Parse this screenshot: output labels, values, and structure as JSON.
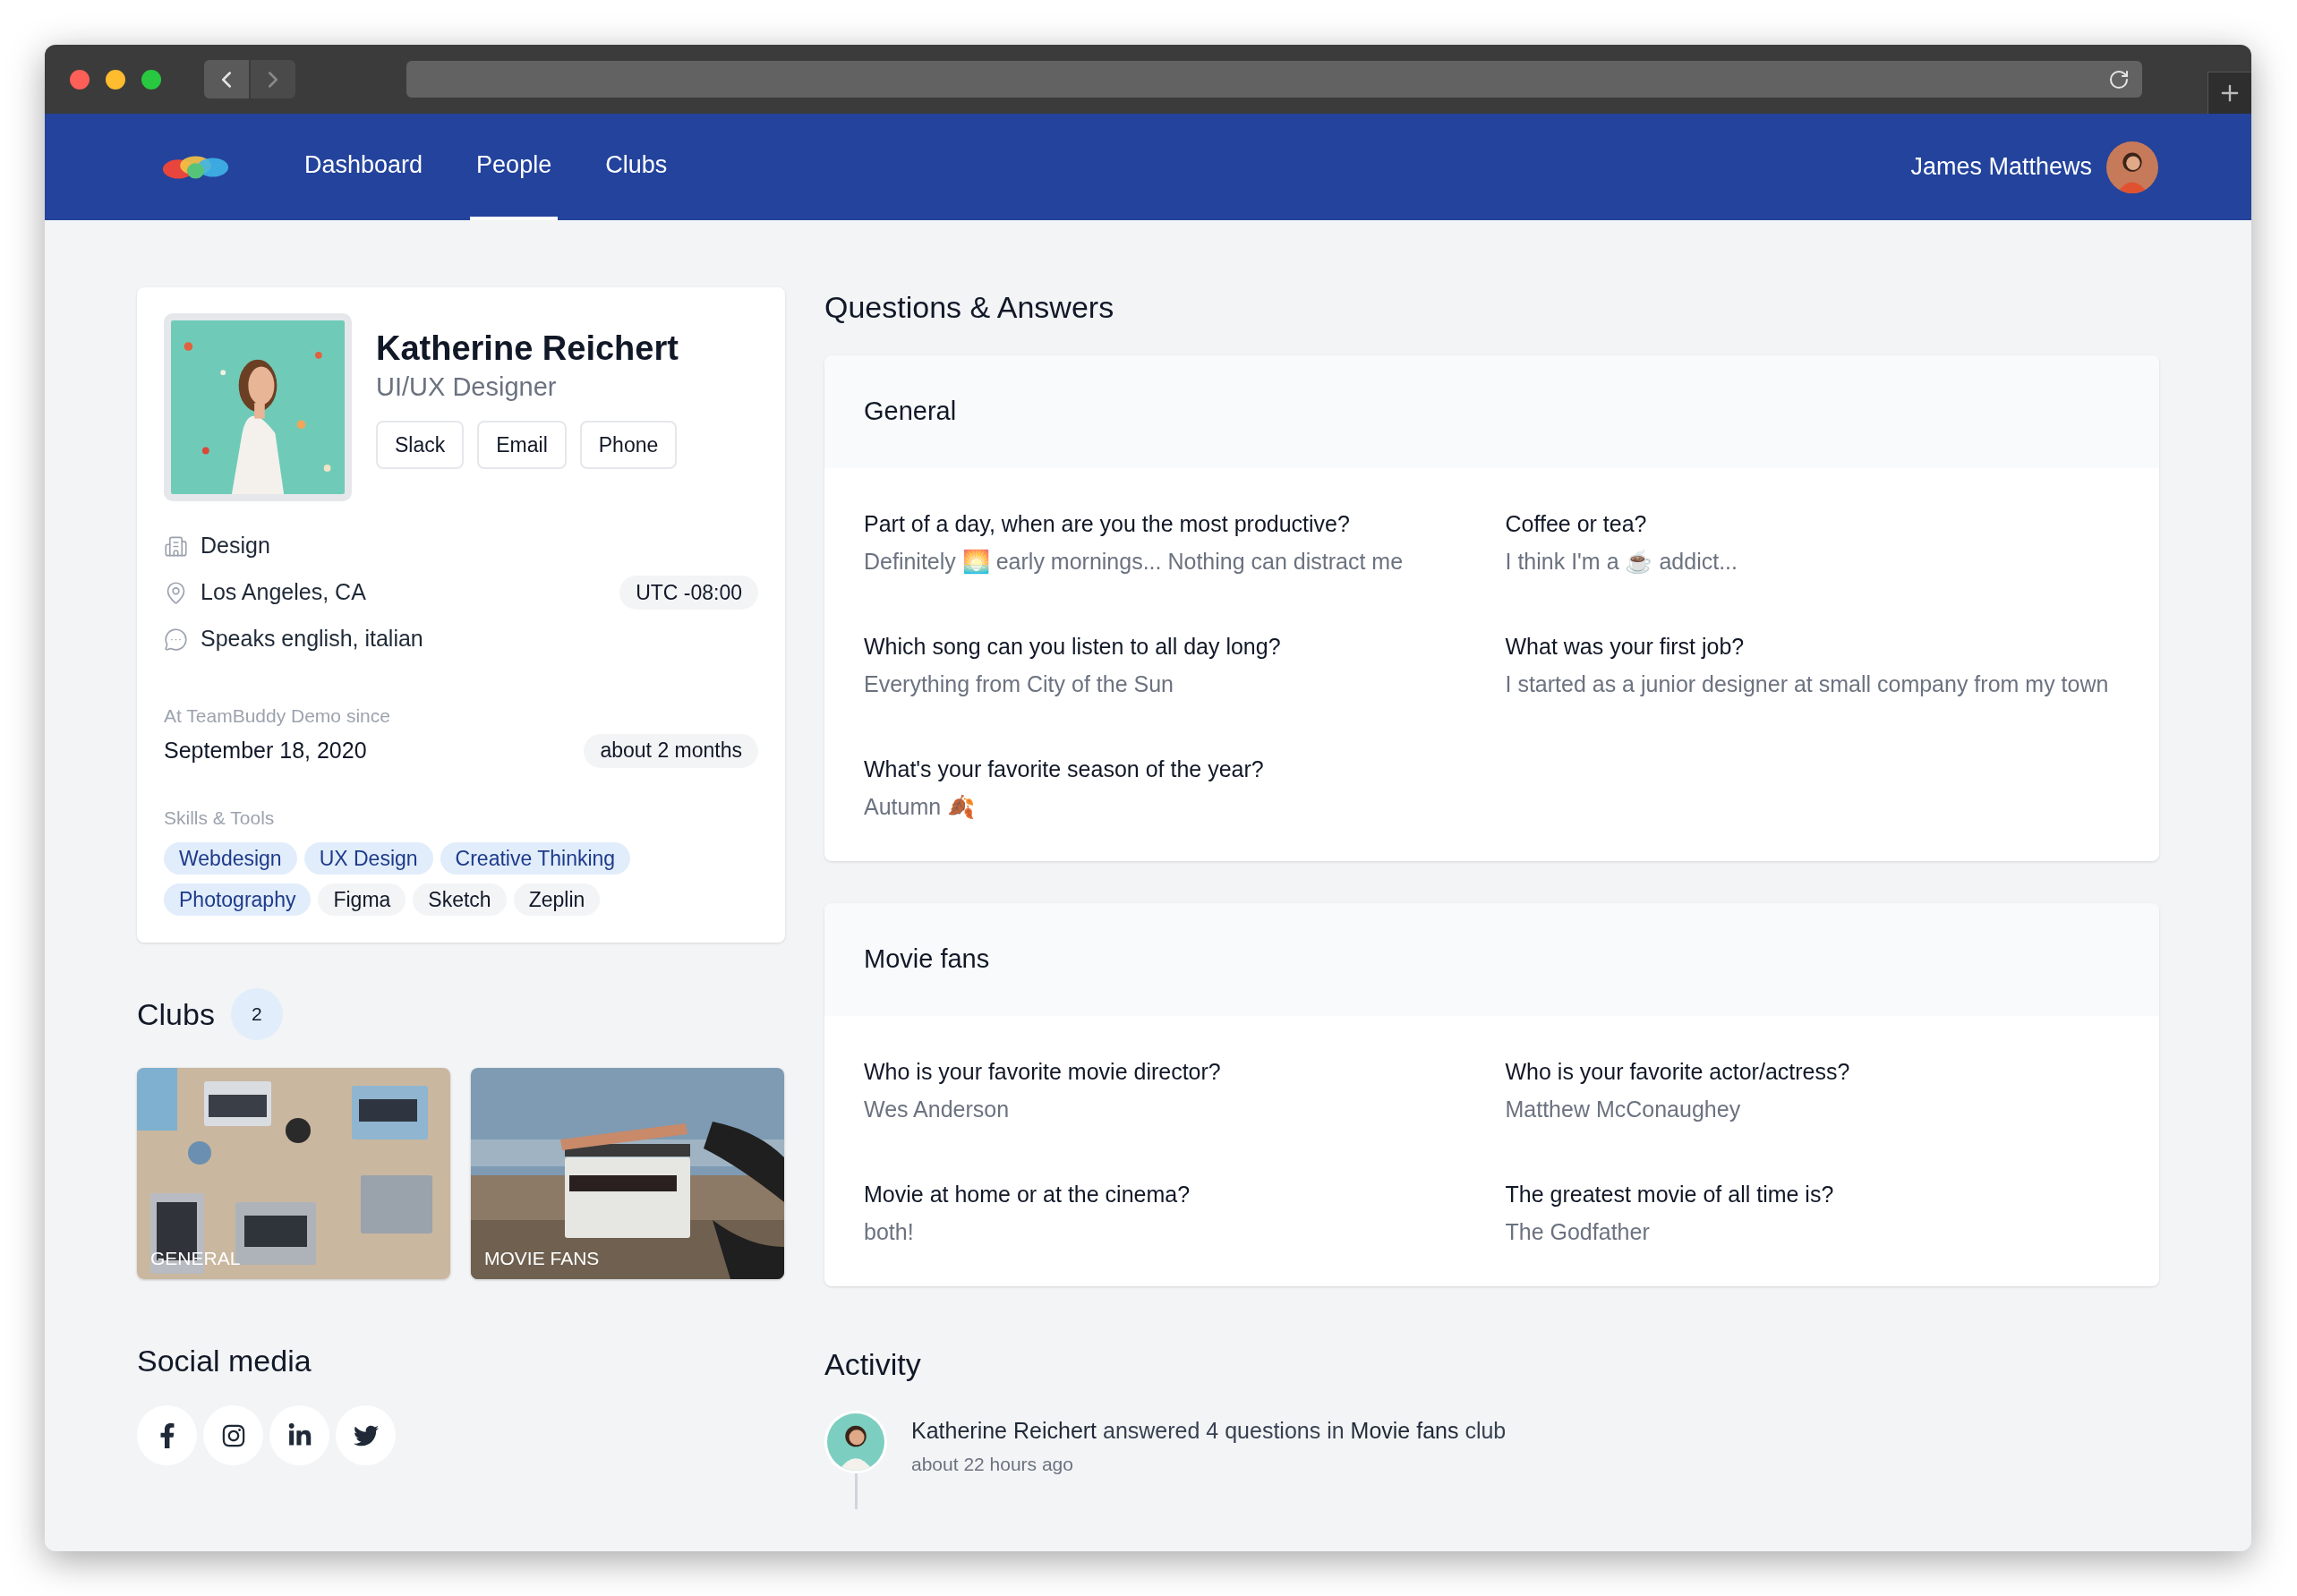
{
  "nav": {
    "items": [
      {
        "label": "Dashboard",
        "selected": false
      },
      {
        "label": "People",
        "selected": true
      },
      {
        "label": "Clubs",
        "selected": false
      }
    ],
    "user": {
      "name": "James Matthews"
    }
  },
  "profile": {
    "name": "Katherine Reichert",
    "title": "UI/UX Designer",
    "contact_buttons": [
      "Slack",
      "Email",
      "Phone"
    ],
    "details": [
      {
        "kind": "department",
        "text": "Design"
      },
      {
        "kind": "location",
        "text": "Los Angeles, CA",
        "badge": "UTC -08:00"
      },
      {
        "kind": "languages",
        "text": "Speaks english, italian"
      }
    ],
    "since_label": "At TeamBuddy Demo since",
    "since_date": "September 18, 2020",
    "since_badge": "about 2 months",
    "skills_label": "Skills & Tools",
    "skills": [
      {
        "label": "Webdesign",
        "kind": "skill"
      },
      {
        "label": "UX Design",
        "kind": "skill"
      },
      {
        "label": "Creative Thinking",
        "kind": "skill"
      },
      {
        "label": "Photography",
        "kind": "skill"
      },
      {
        "label": "Figma",
        "kind": "tool"
      },
      {
        "label": "Sketch",
        "kind": "tool"
      },
      {
        "label": "Zeplin",
        "kind": "tool"
      }
    ]
  },
  "clubs": {
    "title": "Clubs",
    "count": "2",
    "items": [
      {
        "label": "GENERAL",
        "kind": "desk"
      },
      {
        "label": "MOVIE FANS",
        "kind": "clapboard"
      }
    ]
  },
  "social_media": {
    "title": "Social media",
    "links": [
      {
        "kind": "facebook"
      },
      {
        "kind": "instagram"
      },
      {
        "kind": "linkedin"
      },
      {
        "kind": "twitter"
      }
    ]
  },
  "qa": {
    "title": "Questions & Answers",
    "sections": [
      {
        "title": "General",
        "items": [
          {
            "question": "Part of a day, when are you the most productive?",
            "answer": "Definitely 🌅 early mornings... Nothing can distract me"
          },
          {
            "question": "Coffee or tea?",
            "answer": "I think I'm a ☕ addict..."
          },
          {
            "question": "Which song can you listen to all day long?",
            "answer": "Everything from City of the Sun"
          },
          {
            "question": "What was your first job?",
            "answer": "I started as a junior designer at small company from my town"
          },
          {
            "question": "What's your favorite season of the year?",
            "answer": "Autumn 🍂"
          }
        ]
      },
      {
        "title": "Movie fans",
        "items": [
          {
            "question": "Who is your favorite movie director?",
            "answer": "Wes Anderson"
          },
          {
            "question": "Who is your favorite actor/actress?",
            "answer": "Matthew McConaughey"
          },
          {
            "question": "Movie at home or at the cinema?",
            "answer": "both!"
          },
          {
            "question": "The greatest movie of all time is?",
            "answer": "The Godfather"
          }
        ]
      }
    ]
  },
  "activity": {
    "title": "Activity",
    "items": [
      {
        "text": "**Katherine Reichert** answered 4 questions in **Movie fans** club",
        "time": "about 22 hours ago"
      }
    ]
  }
}
